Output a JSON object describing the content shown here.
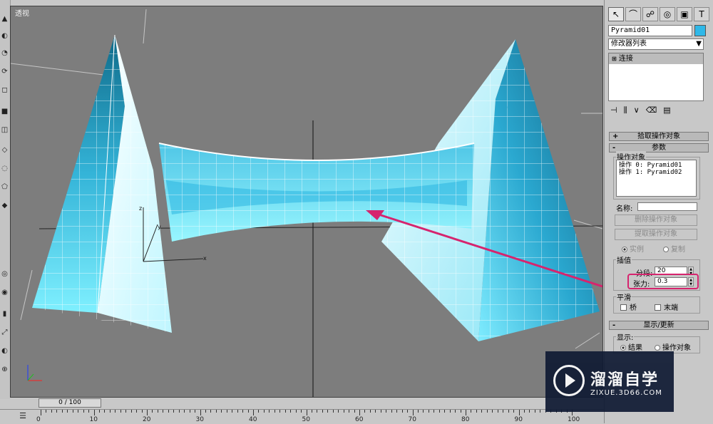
{
  "viewport": {
    "label": "透视"
  },
  "panel": {
    "object_name": "Pyramid01",
    "object_color": "#2fb8e8",
    "modifier_list": "修改器列表",
    "stack_item": "连接",
    "rollouts": {
      "pick": "拾取操作对象",
      "params": "参数",
      "display": "显示/更新"
    },
    "operands_group": "操作对象",
    "operands": [
      "操作 0: Pyramid01",
      "操作 1: Pyramid02"
    ],
    "name_label": "名称:",
    "delete_operand": "删除操作对象",
    "extract_operand": "提取操作对象",
    "radio_instance": "实例",
    "radio_copy": "复制",
    "interp_group": "插值",
    "segments_label": "分段:",
    "segments_value": "20",
    "tension_label": "张力:",
    "tension_value": "0.3",
    "smooth_group": "平滑",
    "bridge_label": "桥",
    "ends_label": "末端",
    "display_group": "显示:",
    "result_label": "结果",
    "operand_label": "操作对象"
  },
  "timeline": {
    "slider": "0 / 100",
    "ticks": [
      "0",
      "10",
      "20",
      "30",
      "40",
      "50",
      "60",
      "70",
      "80",
      "90",
      "100"
    ]
  },
  "watermark": {
    "title": "溜溜自学",
    "url": "ZIXUE.3D66.COM"
  },
  "colors": {
    "annotation": "#d6246e",
    "mesh": "#48d8f0"
  }
}
